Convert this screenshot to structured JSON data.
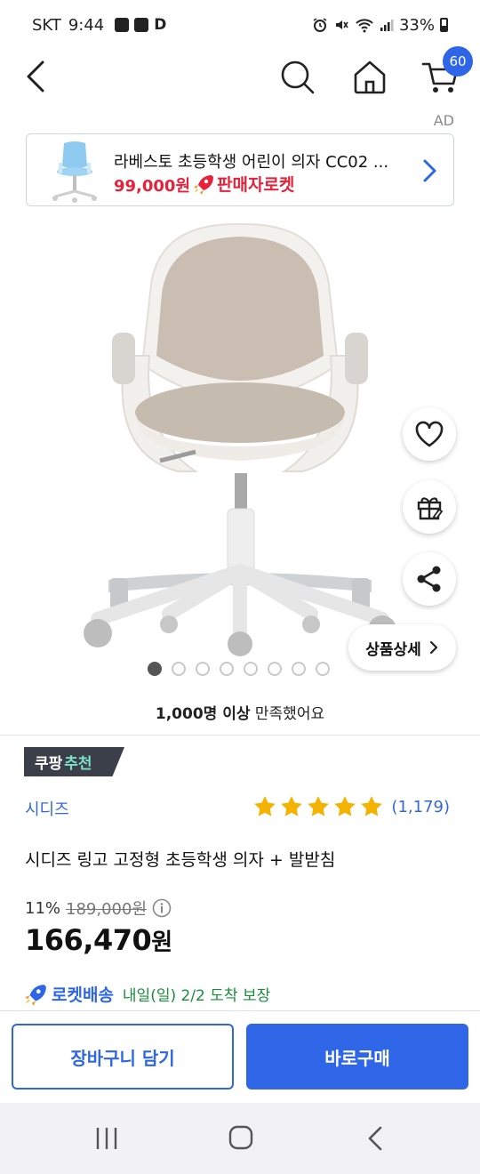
{
  "status_bar": {
    "carrier": "SKT",
    "time": "9:44",
    "status_letter": "D",
    "battery": "33%"
  },
  "nav": {
    "cart_count": "60"
  },
  "ad": {
    "label": "AD",
    "title": "라베스토 초등학생 어린이 의자 CC02 ...",
    "price": "99,000원",
    "delivery_badge": "판매자로켓"
  },
  "gallery": {
    "image_count": 8,
    "active_index": 0,
    "detail_button": "상품상세"
  },
  "satisfaction": {
    "bold": "1,000명 이상",
    "rest": " 만족했어요"
  },
  "recommendation": {
    "brand_part": "쿠팡",
    "accent_part": "추천"
  },
  "product": {
    "brand": "시디즈",
    "rating_stars": 5,
    "review_count": "(1,179)",
    "title": "시디즈 링고 고정형 초등학생 의자 + 발받침",
    "discount_rate": "11%",
    "original_price": "189,000원",
    "sale_price_number": "166,470",
    "sale_price_unit": "원"
  },
  "delivery": {
    "label": "로켓배송",
    "text": "내일(일) 2/2 도착 보장"
  },
  "actions": {
    "add_to_cart": "장바구니 담기",
    "buy_now": "바로구매"
  },
  "colors": {
    "accent_blue": "#2f66e8",
    "sale_red": "#e6223a",
    "delivery_green": "#1a8c3a",
    "star_yellow": "#f5b301"
  }
}
